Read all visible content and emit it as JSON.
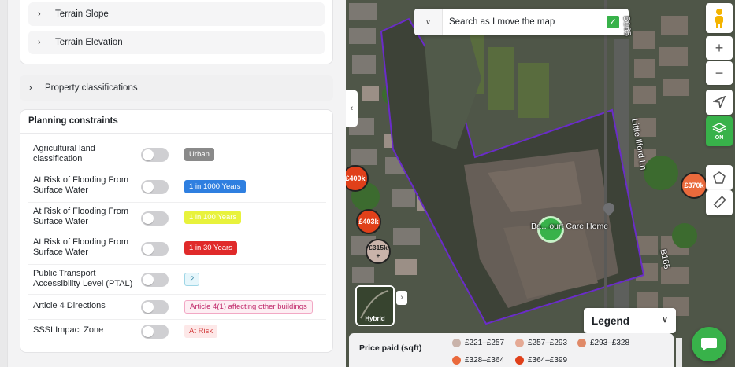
{
  "sidebar": {
    "terrain_slope": "Terrain Slope",
    "terrain_elevation": "Terrain Elevation",
    "property_classifications": "Property classifications",
    "planning_title": "Planning constraints",
    "rows": [
      {
        "label": "Agricultural land classification",
        "badge": "Urban",
        "badge_bg": "#8a8a8a",
        "badge_fg": "#ffffff"
      },
      {
        "label": "At Risk of Flooding From Surface Water",
        "badge": "1 in 1000 Years",
        "badge_bg": "#2f7fe0",
        "badge_fg": "#ffffff"
      },
      {
        "label": "At Risk of Flooding From Surface Water",
        "badge": "1 in 100 Years",
        "badge_bg": "#e8f23c",
        "badge_fg": "#ffffff"
      },
      {
        "label": "At Risk of Flooding From Surface Water",
        "badge": "1 in 30 Years",
        "badge_bg": "#e02a2a",
        "badge_fg": "#ffffff"
      },
      {
        "label": "Public Transport Accessibility Level (PTAL)",
        "badge": "2",
        "badge_bg": "#e6f6fb",
        "badge_fg": "#2a7fa0"
      },
      {
        "label": "Article 4 Directions",
        "badge": "Article 4(1) affecting other buildings",
        "badge_bg": "#fdeef3",
        "badge_fg": "#c0286a"
      },
      {
        "label": "SSSI Impact Zone",
        "badge": "At Risk",
        "badge_bg": "#fde8e8",
        "badge_fg": "#d23a3a"
      }
    ]
  },
  "map": {
    "search_label": "Search as I move the map",
    "search_checked": true,
    "layers_badge": "ON",
    "hybrid_label": "Hybrid",
    "legend_label": "Legend",
    "poi_label": "Ba…ourt Care Home",
    "road_labels": [
      "B165",
      "Little Ilford Ln",
      "B165"
    ],
    "price_pins": [
      "£400k",
      "£403k",
      "£315k",
      "£370k"
    ],
    "price_pin_plus": "+",
    "legend": {
      "title": "Price paid (sqft)",
      "items": [
        {
          "label": "£221–£257",
          "color": "#c9b3aa"
        },
        {
          "label": "£257–£293",
          "color": "#e5aa95"
        },
        {
          "label": "£293–£328",
          "color": "#e08a68"
        },
        {
          "label": "£328–£364",
          "color": "#ea6a3c"
        },
        {
          "label": "£364–£399",
          "color": "#e0401a"
        }
      ]
    }
  },
  "colors": {
    "accent_green": "#38b24a",
    "boundary_purple": "#6a2cc9"
  },
  "icons": [
    "chevron-right-icon",
    "chevron-down-icon",
    "chevron-left-icon",
    "checkbox-checked-icon",
    "pegman-icon",
    "zoom-in-icon",
    "zoom-out-icon",
    "locate-arrow-icon",
    "layers-icon",
    "polygon-draw-icon",
    "ruler-icon",
    "chat-icon",
    "map-pin-icon"
  ]
}
